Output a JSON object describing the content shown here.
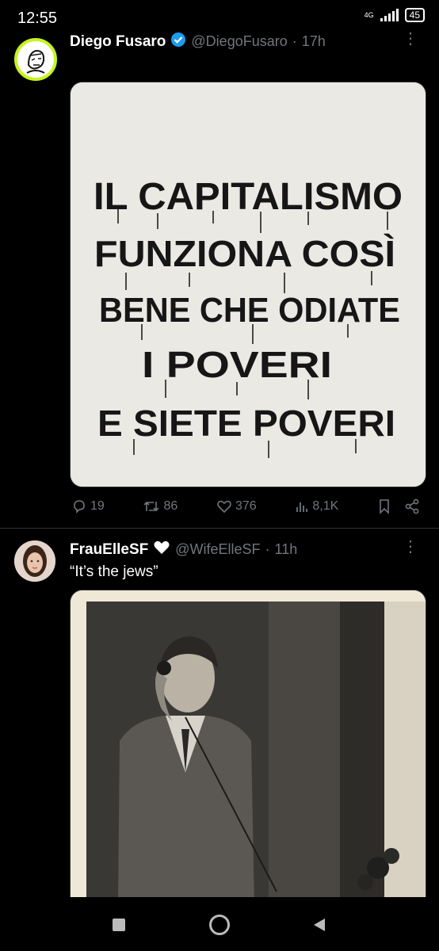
{
  "status_bar": {
    "time": "12:55",
    "network": "4G",
    "battery": "45"
  },
  "tweets": [
    {
      "display_name": "Diego Fusaro",
      "handle": "@DiegoFusaro",
      "separator": "·",
      "time": "17h",
      "image_text": [
        "IL CAPITALISMO",
        "FUNZIONA COSÌ",
        "BENE CHE ODIATE",
        "I POVERI",
        "E SIETE POVERI"
      ],
      "stats": {
        "replies": "19",
        "retweets": "86",
        "likes": "376",
        "views": "8,1K"
      }
    },
    {
      "display_name": "FrauElleSF",
      "handle": "@WifeElleSF",
      "separator": "·",
      "time": "11h",
      "text": "“It’s the jews”"
    }
  ],
  "colors": {
    "background": "#000000",
    "verified": "#1d9bf0",
    "muted": "#71767b",
    "avatar_ring": "#c6f41e"
  }
}
